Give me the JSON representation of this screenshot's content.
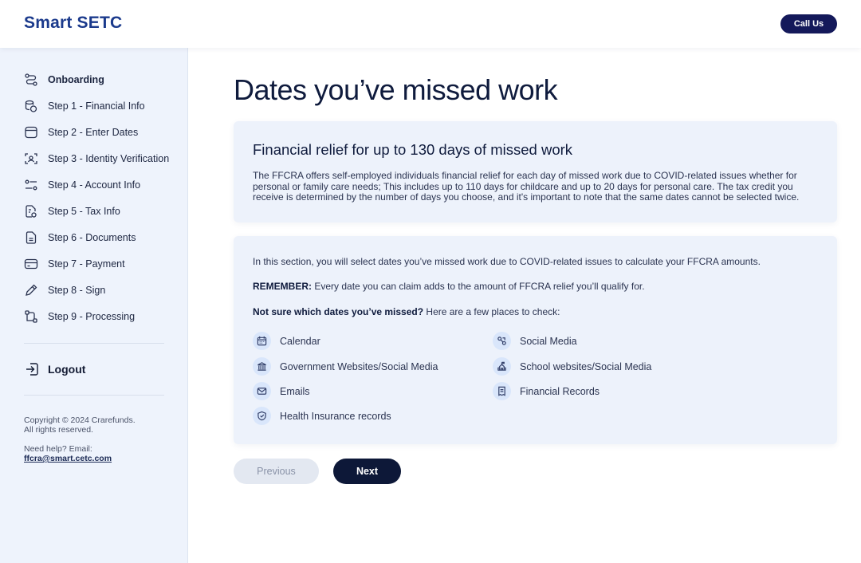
{
  "header": {
    "logo": "Smart SETC",
    "call_label": "Call Us"
  },
  "sidebar": {
    "items": [
      {
        "label": "Onboarding",
        "icon": "route-icon"
      },
      {
        "label": "Step 1 - Financial Info",
        "icon": "coins-icon"
      },
      {
        "label": "Step 2 - Enter Dates",
        "icon": "calendar-icon"
      },
      {
        "label": "Step 3 - Identity Verification",
        "icon": "face-scan-icon"
      },
      {
        "label": "Step 4 - Account Info",
        "icon": "sliders-icon"
      },
      {
        "label": "Step 5 - Tax Info",
        "icon": "tax-document-icon"
      },
      {
        "label": "Step 6 - Documents",
        "icon": "document-icon"
      },
      {
        "label": "Step 7 - Payment",
        "icon": "credit-card-icon"
      },
      {
        "label": "Step 8 - Sign",
        "icon": "pen-icon"
      },
      {
        "label": "Step 9 - Processing",
        "icon": "workflow-icon"
      }
    ],
    "logout": "Logout",
    "copyright_1": "Copyright © 2024 Crarefunds.",
    "copyright_2": "All rights reserved.",
    "help_label": "Need help? Email:",
    "help_email": "ffcra@smart.cetc.com"
  },
  "main": {
    "title": "Dates you’ve missed work",
    "card1": {
      "title": "Financial relief for up to 130 days of missed work",
      "body": "The FFCRA offers self-employed individuals financial relief for each day of missed work due to COVID-related issues whether for personal or family care needs; This includes up to 110 days for childcare and up to 20 days for personal care. The tax credit you receive is determined by the number of days you choose, and it's important to note that the same dates cannot be selected twice."
    },
    "card2": {
      "intro": "In this section, you will select dates you’ve missed work due to COVID-related issues to calculate your FFCRA amounts.",
      "remember_bold": "REMEMBER:",
      "remember_text": " Every date you can claim adds to the amount of FFCRA relief you’ll qualify for.",
      "notsure_bold": "Not sure which dates you’ve missed?",
      "notsure_text": " Here are a few places to check:",
      "sources": [
        {
          "label": "Calendar",
          "icon": "calendar-icon"
        },
        {
          "label": "Social Media",
          "icon": "social-icon"
        },
        {
          "label": "Government Websites/Social Media",
          "icon": "government-building-icon"
        },
        {
          "label": "School websites/Social Media",
          "icon": "school-icon"
        },
        {
          "label": "Emails",
          "icon": "mail-icon"
        },
        {
          "label": "Financial Records",
          "icon": "receipt-icon"
        },
        {
          "label": "Health Insurance records",
          "icon": "shield-icon"
        }
      ]
    },
    "prev_label": "Previous",
    "next_label": "Next"
  }
}
